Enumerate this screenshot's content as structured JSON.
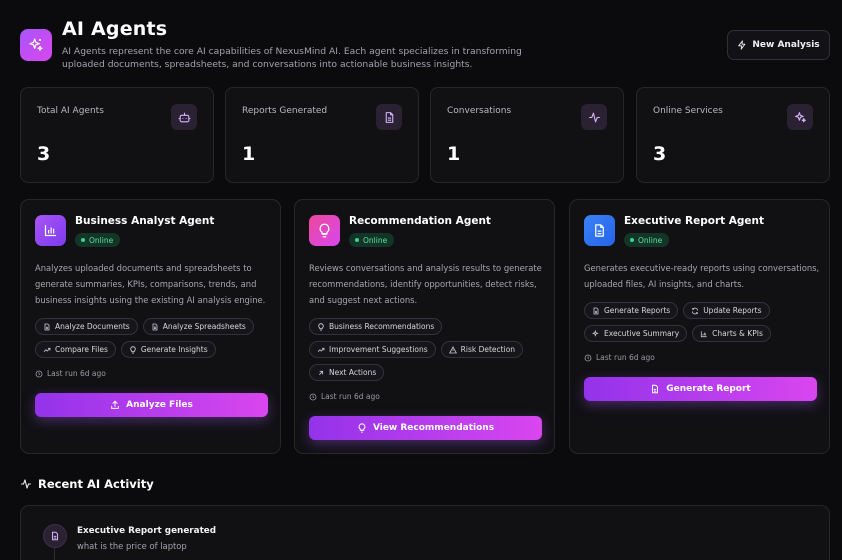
{
  "header": {
    "title": "AI Agents",
    "description": "AI Agents represent the core AI capabilities of NexusMind AI. Each agent specializes in transforming uploaded documents, spreadsheets, and conversations into actionable business insights.",
    "new_analysis_label": "New Analysis",
    "icon": "sparkles-icon"
  },
  "stats": [
    {
      "label": "Total AI Agents",
      "value": "3",
      "icon": "bot-icon"
    },
    {
      "label": "Reports Generated",
      "value": "1",
      "icon": "document-icon"
    },
    {
      "label": "Conversations",
      "value": "1",
      "icon": "activity-icon"
    },
    {
      "label": "Online Services",
      "value": "3",
      "icon": "sparkles-icon"
    }
  ],
  "agents": [
    {
      "name": "Business Analyst Agent",
      "status": "Online",
      "description": "Analyzes uploaded documents and spreadsheets to generate summaries, KPIs, comparisons, trends, and business insights using the existing AI analysis engine.",
      "tags": [
        "Analyze Documents",
        "Analyze Spreadsheets",
        "Compare Files",
        "Generate Insights"
      ],
      "last_run": "Last run 6d ago",
      "button": "Analyze Files",
      "icon": "bar-chart-icon"
    },
    {
      "name": "Recommendation Agent",
      "status": "Online",
      "description": "Reviews conversations and analysis results to generate recommendations, identify opportunities, detect risks, and suggest next actions.",
      "tags": [
        "Business Recommendations",
        "Improvement Suggestions",
        "Risk Detection",
        "Next Actions"
      ],
      "last_run": "Last run 6d ago",
      "button": "View Recommendations",
      "icon": "lightbulb-icon"
    },
    {
      "name": "Executive Report Agent",
      "status": "Online",
      "description": "Generates executive-ready reports using conversations, uploaded files, AI insights, and charts.",
      "tags": [
        "Generate Reports",
        "Update Reports",
        "Executive Summary",
        "Charts & KPIs"
      ],
      "last_run": "Last run 6d ago",
      "button": "Generate Report",
      "icon": "document-icon"
    }
  ],
  "recent": {
    "title": "Recent AI Activity",
    "items": [
      {
        "title": "Executive Report generated",
        "subtitle": "what is the price of laptop"
      }
    ]
  },
  "colors": {
    "accent_start": "#9333ea",
    "accent_end": "#d946ef",
    "online": "#34d399",
    "exec_icon": "#3b82f6"
  }
}
